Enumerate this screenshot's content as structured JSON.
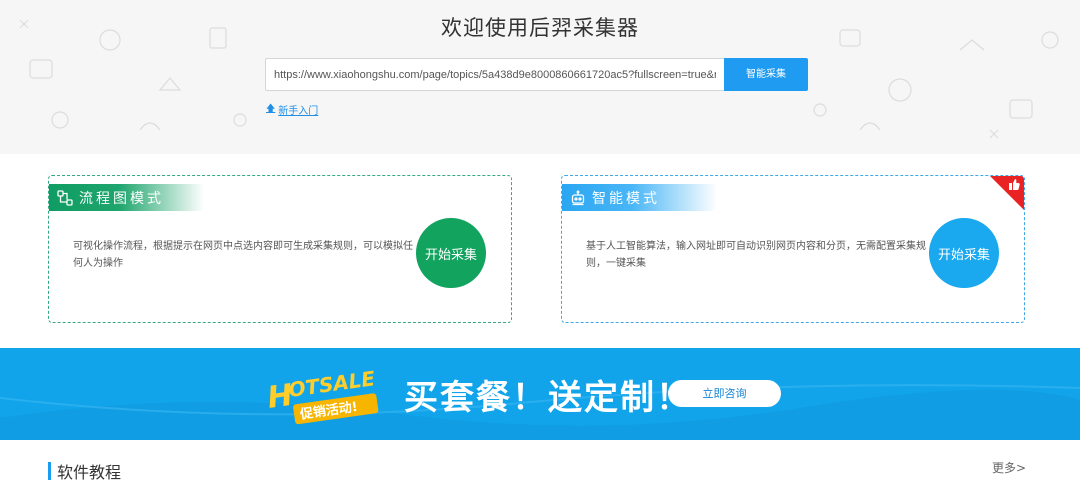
{
  "header": {
    "title": "欢迎使用后羿采集器",
    "url_value": "https://www.xiaohongshu.com/page/topics/5a438d9e8000860661720ac5?fullscreen=true&navi",
    "smart_button_label": "智能采集",
    "beginner_link": "新手入门"
  },
  "cards": [
    {
      "title": "流程图模式",
      "description": "可视化操作流程，根据提示在网页中点选内容即可生成采集规则，可以模拟任何人为操作",
      "button_label": "开始采集",
      "color": "#12a35f"
    },
    {
      "title": "智能模式",
      "description": "基于人工智能算法，输入网址即可自动识别网页内容和分页，无需配置采集规则，一键采集",
      "button_label": "开始采集",
      "color": "#1aa8ef",
      "corner_badge_color": "#e92224"
    }
  ],
  "banner": {
    "logo_text_top": "HOTSALE",
    "logo_text_bottom": "促销活动!",
    "promo_text": "买套餐！送定制！",
    "button_label": "立即咨询",
    "background_color": "#11a4ea"
  },
  "tutorials": {
    "title": "软件教程",
    "more_link": "更多>"
  }
}
